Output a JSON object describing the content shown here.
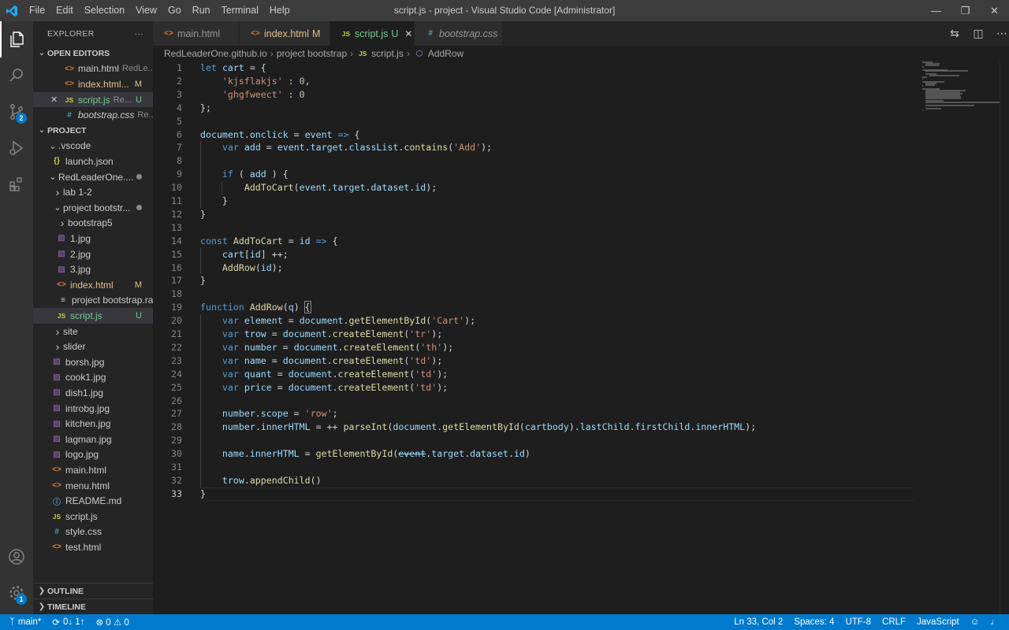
{
  "window": {
    "title": "script.js - project - Visual Studio Code [Administrator]",
    "menu": [
      "File",
      "Edit",
      "Selection",
      "View",
      "Go",
      "Run",
      "Terminal",
      "Help"
    ]
  },
  "activity": {
    "scm_badge": "2",
    "settings_badge": "1"
  },
  "sidebar": {
    "title": "EXPLORER",
    "more": "···",
    "open_editors_title": "OPEN EDITORS",
    "open_editors": [
      {
        "name": "main.html",
        "desc": "RedLe...",
        "icon": "html-icon"
      },
      {
        "name": "index.html...",
        "status": "M",
        "icon": "html-icon"
      },
      {
        "name": "script.js",
        "desc": "Re...",
        "status": "U",
        "icon": "js-icon"
      },
      {
        "name": "bootstrap.css",
        "desc": "Re...",
        "icon": "css-icon"
      }
    ],
    "project_title": "PROJECT",
    "tree": [
      {
        "name": ".vscode",
        "kind": "folder",
        "open": true
      },
      {
        "name": "launch.json",
        "icon": "json-icon"
      },
      {
        "name": "RedLeaderOne....",
        "kind": "folder",
        "open": true
      },
      {
        "name": "lab 1-2",
        "kind": "folder",
        "open": false
      },
      {
        "name": "project bootstr...",
        "kind": "folder",
        "open": true
      },
      {
        "name": "bootstrap5",
        "kind": "folder",
        "open": false
      },
      {
        "name": "1.jpg",
        "icon": "image-icon"
      },
      {
        "name": "2.jpg",
        "icon": "image-icon"
      },
      {
        "name": "3.jpg",
        "icon": "image-icon"
      },
      {
        "name": "index.html",
        "icon": "html-icon",
        "status": "M"
      },
      {
        "name": "project bootstrap.rar",
        "icon": "file-icon"
      },
      {
        "name": "script.js",
        "icon": "js-icon",
        "status": "U"
      },
      {
        "name": "site",
        "kind": "folder",
        "open": false
      },
      {
        "name": "slider",
        "kind": "folder",
        "open": false
      },
      {
        "name": "borsh.jpg",
        "icon": "image-icon"
      },
      {
        "name": "cook1.jpg",
        "icon": "image-icon"
      },
      {
        "name": "dish1.jpg",
        "icon": "image-icon"
      },
      {
        "name": "introbg.jpg",
        "icon": "image-icon"
      },
      {
        "name": "kitchen.jpg",
        "icon": "image-icon"
      },
      {
        "name": "lagman.jpg",
        "icon": "image-icon"
      },
      {
        "name": "logo.jpg",
        "icon": "image-icon"
      },
      {
        "name": "main.html",
        "icon": "html-icon"
      },
      {
        "name": "menu.html",
        "icon": "html-icon"
      },
      {
        "name": "README.md",
        "icon": "info-icon"
      },
      {
        "name": "script.js",
        "icon": "js-icon"
      },
      {
        "name": "style.css",
        "icon": "css-icon"
      },
      {
        "name": "test.html",
        "icon": "html-icon"
      }
    ],
    "outline_title": "OUTLINE",
    "timeline_title": "TIMELINE"
  },
  "tabs": [
    {
      "label": "main.html",
      "icon": "html-icon"
    },
    {
      "label": "index.html",
      "status": "M",
      "icon": "html-icon"
    },
    {
      "label": "script.js",
      "status": "U",
      "icon": "js-icon",
      "active": true
    },
    {
      "label": "bootstrap.css",
      "icon": "css-icon",
      "italic": true
    }
  ],
  "breadcrumb": [
    "RedLeaderOne.github.io",
    "project bootstrap",
    "script.js",
    "AddRow"
  ],
  "editor": {
    "current_line": 33,
    "lines": [
      [
        [
          "kw",
          "let"
        ],
        [
          "pl",
          " "
        ],
        [
          "var",
          "cart"
        ],
        [
          "pl",
          " = {"
        ]
      ],
      [
        [
          "pl",
          "    "
        ],
        [
          "str",
          "'kjsflakjs'"
        ],
        [
          "pl",
          " : "
        ],
        [
          "num",
          "0"
        ],
        [
          "pl",
          ","
        ]
      ],
      [
        [
          "pl",
          "    "
        ],
        [
          "str",
          "'ghgfweect'"
        ],
        [
          "pl",
          " : "
        ],
        [
          "num",
          "0"
        ]
      ],
      [
        [
          "pl",
          "};"
        ]
      ],
      [],
      [
        [
          "var",
          "document"
        ],
        [
          "pl",
          "."
        ],
        [
          "var",
          "onclick"
        ],
        [
          "pl",
          " = "
        ],
        [
          "var",
          "event"
        ],
        [
          "pl",
          " "
        ],
        [
          "kw",
          "=>"
        ],
        [
          "pl",
          " {"
        ]
      ],
      [
        [
          "pl",
          "    "
        ],
        [
          "kw",
          "var"
        ],
        [
          "pl",
          " "
        ],
        [
          "var",
          "add"
        ],
        [
          "pl",
          " = "
        ],
        [
          "var",
          "event"
        ],
        [
          "pl",
          "."
        ],
        [
          "var",
          "target"
        ],
        [
          "pl",
          "."
        ],
        [
          "var",
          "classList"
        ],
        [
          "pl",
          "."
        ],
        [
          "fn",
          "contains"
        ],
        [
          "pl",
          "("
        ],
        [
          "str",
          "'Add'"
        ],
        [
          "pl",
          ");"
        ]
      ],
      [],
      [
        [
          "pl",
          "    "
        ],
        [
          "kw",
          "if"
        ],
        [
          "pl",
          " ( "
        ],
        [
          "var",
          "add"
        ],
        [
          "pl",
          " ) {"
        ]
      ],
      [
        [
          "pl",
          "        "
        ],
        [
          "fn",
          "AddToCart"
        ],
        [
          "pl",
          "("
        ],
        [
          "var",
          "event"
        ],
        [
          "pl",
          "."
        ],
        [
          "var",
          "target"
        ],
        [
          "pl",
          "."
        ],
        [
          "var",
          "dataset"
        ],
        [
          "pl",
          "."
        ],
        [
          "var",
          "id"
        ],
        [
          "pl",
          ");"
        ]
      ],
      [
        [
          "pl",
          "    }"
        ]
      ],
      [
        [
          "pl",
          "}"
        ]
      ],
      [],
      [
        [
          "kw",
          "const"
        ],
        [
          "pl",
          " "
        ],
        [
          "fn",
          "AddToCart"
        ],
        [
          "pl",
          " = "
        ],
        [
          "var",
          "id"
        ],
        [
          "pl",
          " "
        ],
        [
          "kw",
          "=>"
        ],
        [
          "pl",
          " {"
        ]
      ],
      [
        [
          "pl",
          "    "
        ],
        [
          "var",
          "cart"
        ],
        [
          "pl",
          "["
        ],
        [
          "var",
          "id"
        ],
        [
          "pl",
          "] ++;"
        ]
      ],
      [
        [
          "pl",
          "    "
        ],
        [
          "fn",
          "AddRow"
        ],
        [
          "pl",
          "("
        ],
        [
          "var",
          "id"
        ],
        [
          "pl",
          ");"
        ]
      ],
      [
        [
          "pl",
          "}"
        ]
      ],
      [],
      [
        [
          "kw",
          "function"
        ],
        [
          "pl",
          " "
        ],
        [
          "fn",
          "AddRow"
        ],
        [
          "pl",
          "("
        ],
        [
          "var",
          "q"
        ],
        [
          "pl",
          ") "
        ],
        [
          "brk",
          "{"
        ]
      ],
      [
        [
          "pl",
          "    "
        ],
        [
          "kw",
          "var"
        ],
        [
          "pl",
          " "
        ],
        [
          "var",
          "element"
        ],
        [
          "pl",
          " = "
        ],
        [
          "var",
          "document"
        ],
        [
          "pl",
          "."
        ],
        [
          "fn",
          "getElementById"
        ],
        [
          "pl",
          "("
        ],
        [
          "str",
          "'Cart'"
        ],
        [
          "pl",
          ");"
        ]
      ],
      [
        [
          "pl",
          "    "
        ],
        [
          "kw",
          "var"
        ],
        [
          "pl",
          " "
        ],
        [
          "var",
          "trow"
        ],
        [
          "pl",
          " = "
        ],
        [
          "var",
          "document"
        ],
        [
          "pl",
          "."
        ],
        [
          "fn",
          "createElement"
        ],
        [
          "pl",
          "("
        ],
        [
          "str",
          "'tr'"
        ],
        [
          "pl",
          ");"
        ]
      ],
      [
        [
          "pl",
          "    "
        ],
        [
          "kw",
          "var"
        ],
        [
          "pl",
          " "
        ],
        [
          "var",
          "number"
        ],
        [
          "pl",
          " = "
        ],
        [
          "var",
          "document"
        ],
        [
          "pl",
          "."
        ],
        [
          "fn",
          "createElement"
        ],
        [
          "pl",
          "("
        ],
        [
          "str",
          "'th'"
        ],
        [
          "pl",
          ");"
        ]
      ],
      [
        [
          "pl",
          "    "
        ],
        [
          "kw",
          "var"
        ],
        [
          "pl",
          " "
        ],
        [
          "var",
          "name"
        ],
        [
          "pl",
          " = "
        ],
        [
          "var",
          "document"
        ],
        [
          "pl",
          "."
        ],
        [
          "fn",
          "createElement"
        ],
        [
          "pl",
          "("
        ],
        [
          "str",
          "'td'"
        ],
        [
          "pl",
          ");"
        ]
      ],
      [
        [
          "pl",
          "    "
        ],
        [
          "kw",
          "var"
        ],
        [
          "pl",
          " "
        ],
        [
          "var",
          "quant"
        ],
        [
          "pl",
          " = "
        ],
        [
          "var",
          "document"
        ],
        [
          "pl",
          "."
        ],
        [
          "fn",
          "createElement"
        ],
        [
          "pl",
          "("
        ],
        [
          "str",
          "'td'"
        ],
        [
          "pl",
          ");"
        ]
      ],
      [
        [
          "pl",
          "    "
        ],
        [
          "kw",
          "var"
        ],
        [
          "pl",
          " "
        ],
        [
          "var",
          "price"
        ],
        [
          "pl",
          " = "
        ],
        [
          "var",
          "document"
        ],
        [
          "pl",
          "."
        ],
        [
          "fn",
          "createElement"
        ],
        [
          "pl",
          "("
        ],
        [
          "str",
          "'td'"
        ],
        [
          "pl",
          ");"
        ]
      ],
      [],
      [
        [
          "pl",
          "    "
        ],
        [
          "var",
          "number"
        ],
        [
          "pl",
          "."
        ],
        [
          "var",
          "scope"
        ],
        [
          "pl",
          " = "
        ],
        [
          "str",
          "'row'"
        ],
        [
          "pl",
          ";"
        ]
      ],
      [
        [
          "pl",
          "    "
        ],
        [
          "var",
          "number"
        ],
        [
          "pl",
          "."
        ],
        [
          "var",
          "innerHTML"
        ],
        [
          "pl",
          " = ++ "
        ],
        [
          "fn",
          "parseInt"
        ],
        [
          "pl",
          "("
        ],
        [
          "var",
          "document"
        ],
        [
          "pl",
          "."
        ],
        [
          "fn",
          "getElementById"
        ],
        [
          "pl",
          "("
        ],
        [
          "var",
          "cartbody"
        ],
        [
          "pl",
          ")."
        ],
        [
          "var",
          "lastChild"
        ],
        [
          "pl",
          "."
        ],
        [
          "var",
          "firstChild"
        ],
        [
          "pl",
          "."
        ],
        [
          "var",
          "innerHTML"
        ],
        [
          "pl",
          ");"
        ]
      ],
      [],
      [
        [
          "pl",
          "    "
        ],
        [
          "var",
          "name"
        ],
        [
          "pl",
          "."
        ],
        [
          "var",
          "innerHTML"
        ],
        [
          "pl",
          " = "
        ],
        [
          "fn",
          "getElementById"
        ],
        [
          "pl",
          "("
        ],
        [
          "strike",
          "event"
        ],
        [
          "pl",
          "."
        ],
        [
          "var",
          "target"
        ],
        [
          "pl",
          "."
        ],
        [
          "var",
          "dataset"
        ],
        [
          "pl",
          "."
        ],
        [
          "var",
          "id"
        ],
        [
          "pl",
          ")"
        ]
      ],
      [],
      [
        [
          "pl",
          "    "
        ],
        [
          "var",
          "trow"
        ],
        [
          "pl",
          "."
        ],
        [
          "fn",
          "appendChild"
        ],
        [
          "pl",
          "()"
        ]
      ],
      [
        [
          "pl",
          "}"
        ]
      ]
    ]
  },
  "status": {
    "branch": "main*",
    "sync": "0↓ 1↑",
    "problems": "⊗ 0 ⚠ 0",
    "position": "Ln 33, Col 2",
    "spaces": "Spaces: 4",
    "encoding": "UTF-8",
    "eol": "CRLF",
    "language": "JavaScript"
  },
  "colors": {
    "accent": "#007acc",
    "titlebar": "#3c3c3c",
    "sidebar": "#252526",
    "editor": "#1e1e1e"
  }
}
